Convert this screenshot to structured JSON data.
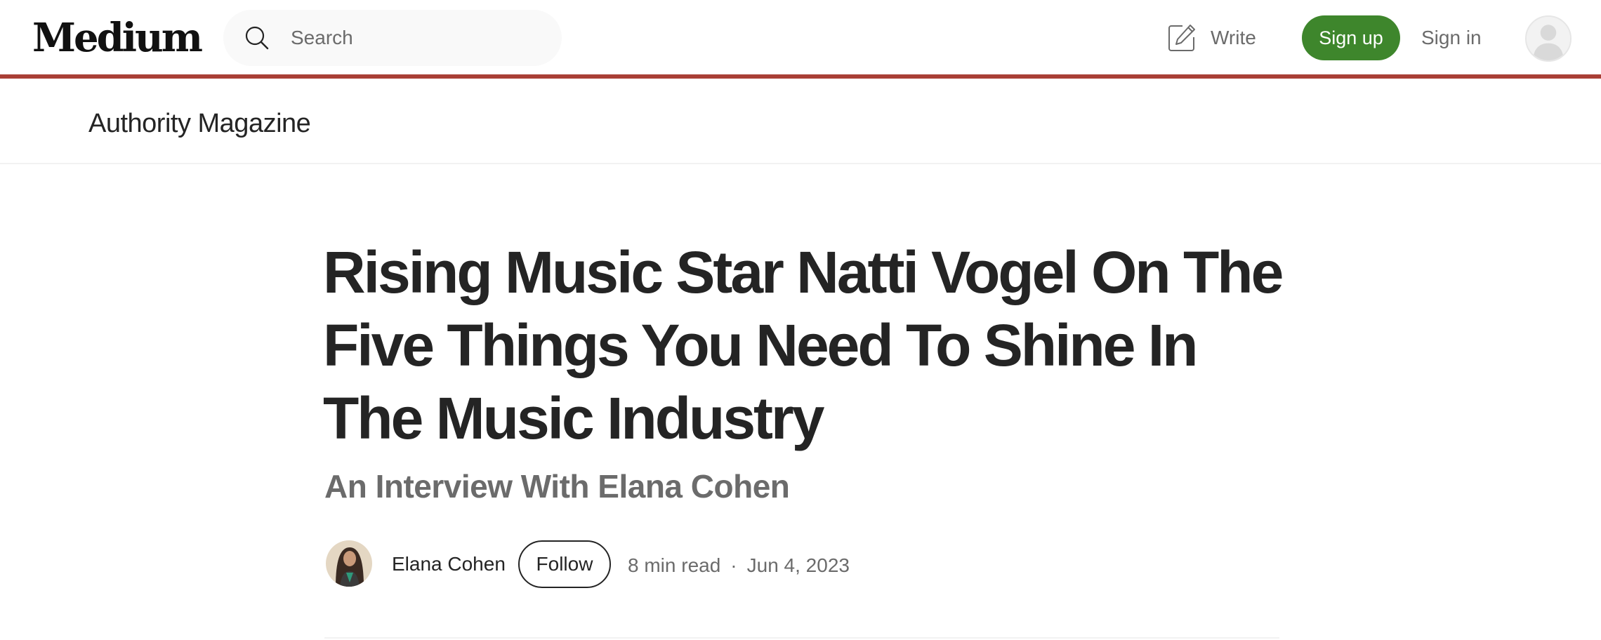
{
  "nav": {
    "logo": "Medium",
    "search": {
      "placeholder": "Search",
      "value": ""
    },
    "write_label": "Write",
    "signup_label": "Sign up",
    "signin_label": "Sign in"
  },
  "publication": {
    "name": "Authority Magazine"
  },
  "article": {
    "title": "Rising Music Star Natti Vogel On The Five Things You Need To Shine In The Music Industry",
    "subtitle": "An Interview With Elana Cohen",
    "author": "Elana Cohen",
    "follow_label": "Follow",
    "read_time": "8 min read",
    "separator": "·",
    "date": "Jun 4, 2023"
  },
  "colors": {
    "accent_green": "#3e862c",
    "header_border": "#a93f36",
    "text_primary": "#242424",
    "text_secondary": "#6b6b6b"
  },
  "icons": {
    "search": "search-icon",
    "write": "write-icon",
    "user": "user-avatar-icon"
  }
}
